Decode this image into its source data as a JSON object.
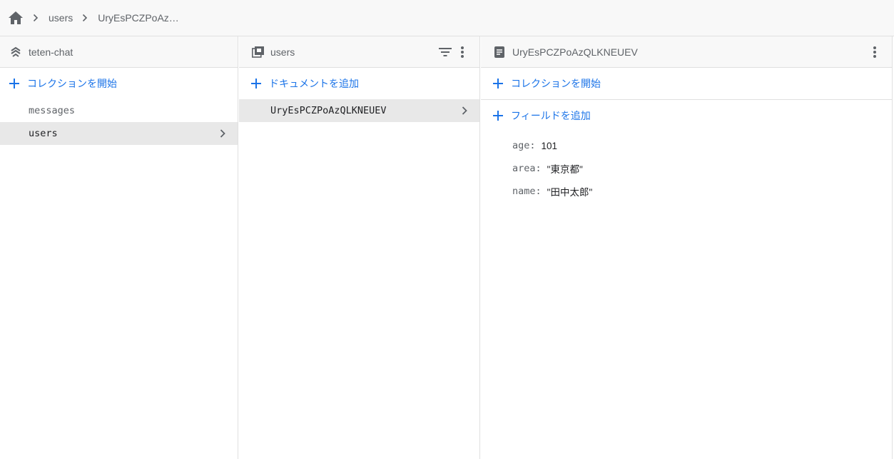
{
  "breadcrumb": {
    "home_icon": "home-icon",
    "items": [
      "users",
      "UryEsPCZPoAz…"
    ]
  },
  "panel_root": {
    "icon": "database-icon",
    "title": "teten-chat",
    "add_label": "コレクションを開始",
    "collections": [
      "messages",
      "users"
    ],
    "selected": "users"
  },
  "panel_collection": {
    "icon": "collection-icon",
    "title": "users",
    "add_label": "ドキュメントを追加",
    "documents": [
      "UryEsPCZPoAzQLKNEUEV"
    ],
    "selected": "UryEsPCZPoAzQLKNEUEV"
  },
  "panel_document": {
    "icon": "document-icon",
    "title": "UryEsPCZPoAzQLKNEUEV",
    "add_collection_label": "コレクションを開始",
    "add_field_label": "フィールドを追加",
    "fields": [
      {
        "key": "age",
        "value": "101"
      },
      {
        "key": "area",
        "value": "\"東京都\""
      },
      {
        "key": "name",
        "value": "\"田中太郎\""
      }
    ]
  },
  "colors": {
    "accent": "#1a73e8",
    "selected_bg": "#e8e8e8",
    "header_bg": "#f8f8f8",
    "border": "#e0e0e0"
  }
}
